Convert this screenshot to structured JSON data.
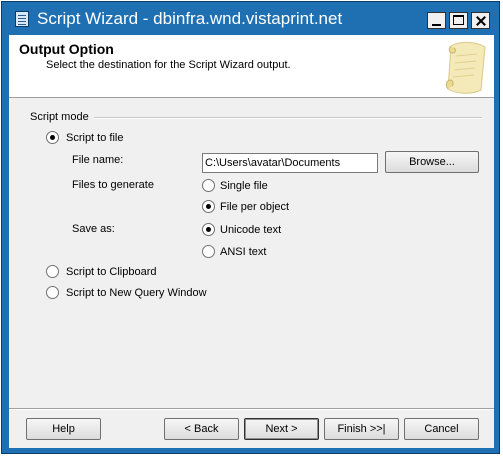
{
  "window": {
    "title": "Script Wizard - dbinfra.wnd.vistaprint.net"
  },
  "header": {
    "title": "Output Option",
    "subtitle": "Select the destination for the Script Wizard output.",
    "icon": "scroll-icon"
  },
  "script_mode": {
    "group_label": "Script mode",
    "options": [
      {
        "label": "Script to file",
        "checked": true
      },
      {
        "label": "Script to Clipboard",
        "checked": false
      },
      {
        "label": "Script to New Query Window",
        "checked": false
      }
    ],
    "file_name": {
      "label": "File name:",
      "value": "C:\\Users\\avatar\\Documents"
    },
    "browse_label": "Browse...",
    "files_to_generate": {
      "label": "Files to generate",
      "options": [
        {
          "label": "Single file",
          "checked": false
        },
        {
          "label": "File per object",
          "checked": true
        }
      ]
    },
    "save_as": {
      "label": "Save as:",
      "options": [
        {
          "label": "Unicode text",
          "checked": true
        },
        {
          "label": "ANSI text",
          "checked": false
        }
      ]
    }
  },
  "footer": {
    "help": "Help",
    "back": "< Back",
    "next": "Next >",
    "finish": "Finish >>|",
    "cancel": "Cancel"
  }
}
